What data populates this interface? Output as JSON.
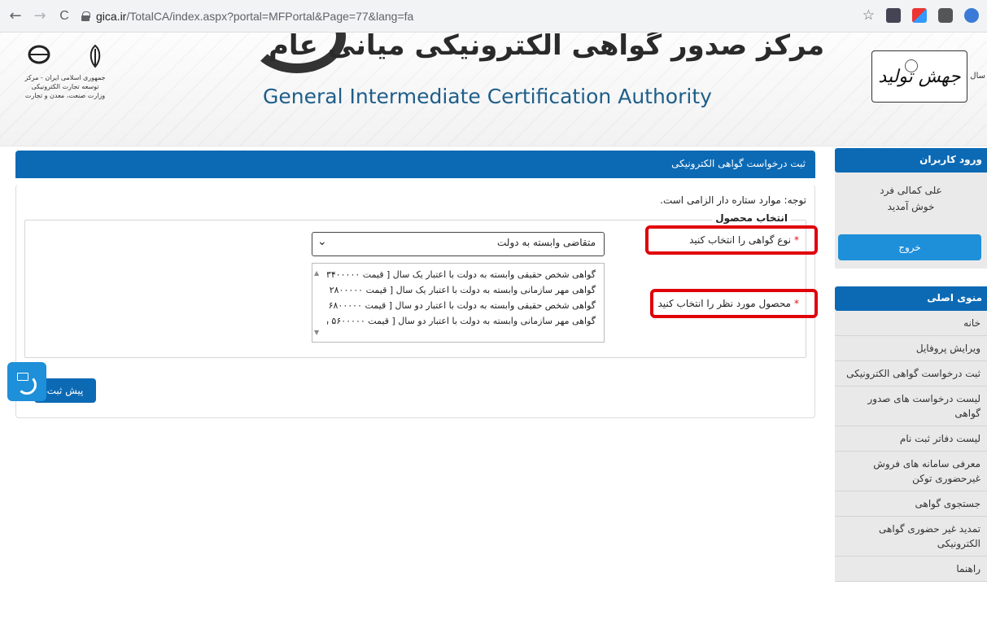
{
  "browser": {
    "back": "←",
    "forward": "→",
    "reload": "C",
    "url_host": "gica.ir",
    "url_path": "/TotalCA/index.aspx?portal=MFPortal&Page=77&lang=fa",
    "star": "☆"
  },
  "banner": {
    "title_fa": "مرکز صدور گواهی الکترونیکی میانی عام",
    "title_en": "General Intermediate Certification Authority",
    "logo_caption_1": "جمهوری اسلامی ایران - مرکز توسعه تجارت الکترونیکی",
    "logo_caption_2": "وزارت صنعت، معدن و تجارت",
    "slogan": "جهش تولید",
    "slogan_prefix": "سال",
    "colors": {
      "title_en": "#1e5e8a"
    }
  },
  "sidebar": {
    "login_header": "ورود کاربران",
    "user_name": "علی کمالی فرد",
    "welcome": "خوش آمدید",
    "logout": "خروج",
    "menu_header": "منوی اصلی",
    "menu_items": [
      "خانه",
      "ویرایش پروفایل",
      "ثبت درخواست گواهی الکترونیکی",
      "لیست درخواست های صدور گواهی",
      "لیست دفاتر ثبت نام",
      "معرفی سامانه های فروش غیرحضوری توکن",
      "جستجوی گواهی",
      "تمدید غیر حضوری گواهی الکترونیکی",
      "راهنما"
    ]
  },
  "main": {
    "header": "ثبت درخواست گواهی الکترونیکی",
    "note": "توجه: موارد ستاره دار الزامی است.",
    "legend": "انتخاب محصول",
    "cert_type_label": "نوع گواهی را انتخاب کنید",
    "cert_type_value": "متقاضی وابسته به دولت",
    "product_label": "محصول مورد نظر را انتخاب کنید",
    "products": [
      "گواهی شخص حقیقی وابسته به دولت با اعتبار یک سال [ قیمت ۳۴۰۰۰۰۰ ریال]",
      "گواهی مهر سازمانی وابسته به دولت با اعتبار یک سال [ قیمت ۲۸۰۰۰۰۰ ریال]",
      "گواهی شخص حقیقی وابسته به دولت با اعتبار دو سال [ قیمت ۶۸۰۰۰۰۰ ریال]",
      "گواهی مهر سازمانی وابسته به دولت با اعتبار دو سال [ قیمت ۵۶۰۰۰۰۰ ریال]"
    ],
    "submit": "پیش ثبت",
    "required_star": "*"
  },
  "colors": {
    "primary_blue": "#0c6ab5",
    "highlight_red": "#e0000a",
    "button_blue": "#1e8fd9"
  }
}
